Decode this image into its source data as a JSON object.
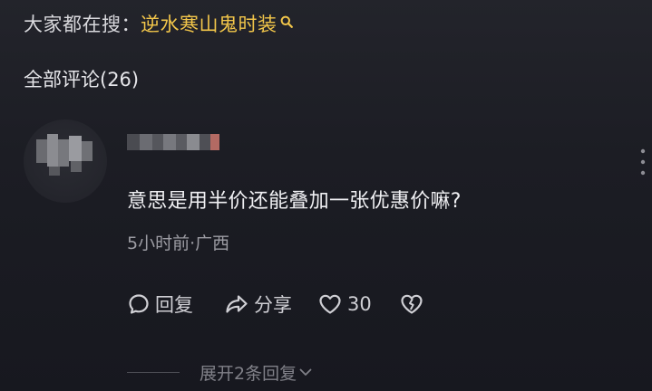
{
  "search_hint": {
    "prefix": "大家都在搜：",
    "term": "逆水寒山鬼时装"
  },
  "comments_header": "全部评论(26)",
  "comment": {
    "text": "意思是用半价还能叠加一张优惠价嘛?",
    "meta": "5小时前·广西",
    "actions": {
      "reply_label": "回复",
      "share_label": "分享",
      "like_count": "30"
    },
    "expand_label": "展开2条回复"
  },
  "colors": {
    "background": "#1c1d24",
    "search_term": "#f2c64a",
    "secondary_text": "#9c9ca3"
  },
  "icons": [
    "search-icon",
    "more-icon",
    "comment-icon",
    "share-icon",
    "heart-icon",
    "broken-heart-icon",
    "chevron-down-icon"
  ]
}
